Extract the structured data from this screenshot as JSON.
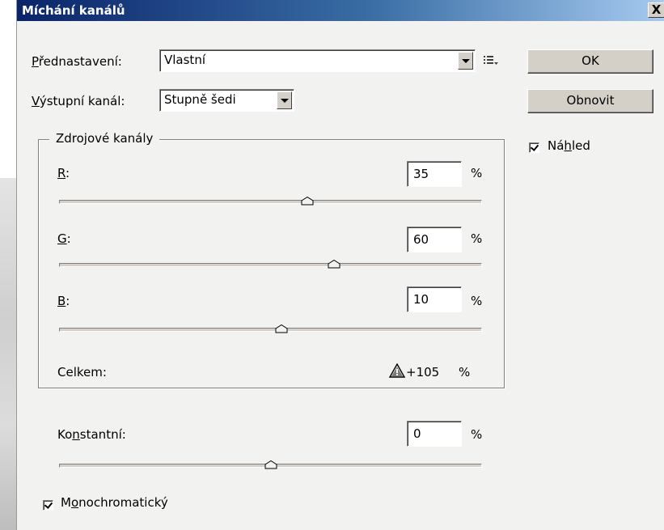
{
  "window": {
    "title": "Míchání kanálů",
    "close_label": "X"
  },
  "preset": {
    "label_prefix": "P",
    "label_rest": "řednastavení:",
    "value": "Vlastní"
  },
  "output_channel": {
    "label_prefix": "V",
    "label_rest": "ýstupní kanál:",
    "value": "Stupně šedi"
  },
  "buttons": {
    "ok": "OK",
    "reset": "Obnovit"
  },
  "preview": {
    "label_a": "Ná",
    "label_u": "h",
    "label_b": "led",
    "checked": true
  },
  "source_channels": {
    "title": "Zdrojové kanály",
    "channels": [
      {
        "key": "R",
        "suffix": ":",
        "value": "35",
        "unit": "%",
        "slider_value": 35
      },
      {
        "key": "G",
        "suffix": ":",
        "value": "60",
        "unit": "%",
        "slider_value": 60
      },
      {
        "key": "B",
        "suffix": ":",
        "value": "10",
        "unit": "%",
        "slider_value": 10
      }
    ],
    "total_label": "Celkem:",
    "total_value": "+105",
    "total_unit": "%",
    "warning_icon": "warning-icon"
  },
  "constant": {
    "label_a": "Ko",
    "label_u": "n",
    "label_b": "stantní:",
    "value": "0",
    "unit": "%",
    "slider_value": 0
  },
  "monochrome": {
    "label_a": "M",
    "label_u": "o",
    "label_b": "nochromatický",
    "checked": true
  },
  "slider_range": {
    "min": -200,
    "max": 200
  }
}
